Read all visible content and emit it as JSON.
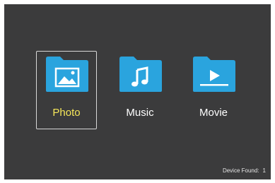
{
  "colors": {
    "background": "#3b3b3c",
    "folder": "#2aa4de",
    "glyph": "#ffffff",
    "selected_label": "#f6e75a",
    "label": "#ffffff",
    "selection_border": "#d8d8d8"
  },
  "menu": {
    "selected_index": 0,
    "items": [
      {
        "label": "Photo",
        "icon": "photo-folder-icon",
        "selected": true
      },
      {
        "label": "Music",
        "icon": "music-folder-icon",
        "selected": false
      },
      {
        "label": "Movie",
        "icon": "movie-folder-icon",
        "selected": false
      }
    ]
  },
  "status": {
    "device_found_label": "Device Found:",
    "device_found_count": "1"
  }
}
